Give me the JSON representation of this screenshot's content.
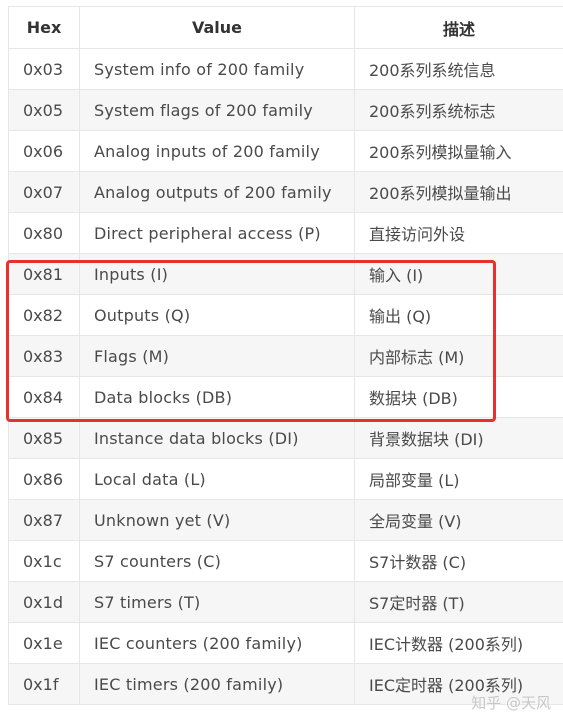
{
  "table": {
    "headers": [
      "Hex",
      "Value",
      "描述"
    ],
    "rows": [
      {
        "hex": "0x03",
        "value": "System info of 200 family",
        "desc": "200系列系统信息"
      },
      {
        "hex": "0x05",
        "value": "System flags of 200 family",
        "desc": "200系列系统标志"
      },
      {
        "hex": "0x06",
        "value": "Analog inputs of 200 family",
        "desc": "200系列模拟量输入"
      },
      {
        "hex": "0x07",
        "value": "Analog outputs of 200 family",
        "desc": "200系列模拟量输出"
      },
      {
        "hex": "0x80",
        "value": "Direct peripheral access (P)",
        "desc": "直接访问外设"
      },
      {
        "hex": "0x81",
        "value": "Inputs (I)",
        "desc": "输入 (I)"
      },
      {
        "hex": "0x82",
        "value": "Outputs (Q)",
        "desc": "输出 (Q)"
      },
      {
        "hex": "0x83",
        "value": "Flags (M)",
        "desc": "内部标志 (M)"
      },
      {
        "hex": "0x84",
        "value": "Data blocks (DB)",
        "desc": "数据块 (DB)"
      },
      {
        "hex": "0x85",
        "value": "Instance data blocks (DI)",
        "desc": "背景数据块 (DI)"
      },
      {
        "hex": "0x86",
        "value": "Local data (L)",
        "desc": "局部变量 (L)"
      },
      {
        "hex": "0x87",
        "value": "Unknown yet (V)",
        "desc": "全局变量 (V)"
      },
      {
        "hex": "0x1c",
        "value": "S7 counters (C)",
        "desc": "S7计数器 (C)"
      },
      {
        "hex": "0x1d",
        "value": "S7 timers (T)",
        "desc": "S7定时器 (T)"
      },
      {
        "hex": "0x1e",
        "value": "IEC counters (200 family)",
        "desc": "IEC计数器 (200系列)"
      },
      {
        "hex": "0x1f",
        "value": "IEC timers (200 family)",
        "desc": "IEC定时器 (200系列)"
      }
    ]
  },
  "highlight": {
    "color": "#e8302d",
    "rows": [
      "0x81",
      "0x82",
      "0x83",
      "0x84"
    ]
  },
  "watermark": "知乎 @天风"
}
